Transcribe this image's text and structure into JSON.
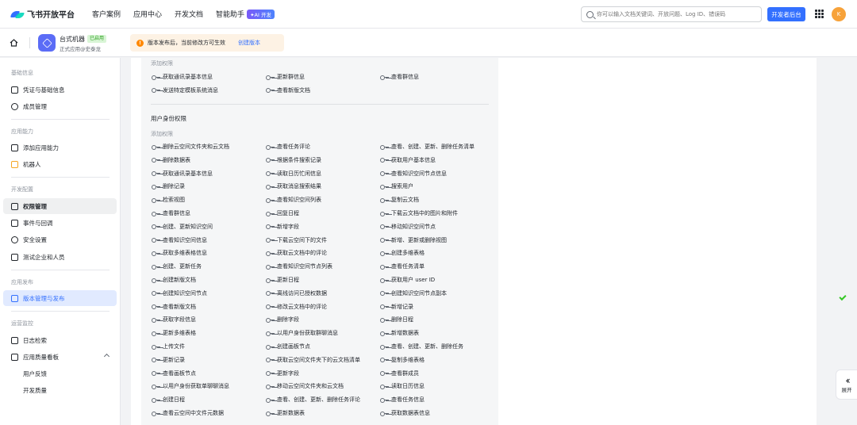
{
  "topnav": {
    "logo_text": "飞书开放平台",
    "links": [
      "客户案例",
      "应用中心",
      "开发文档"
    ],
    "ai_link": "智能助手",
    "ai_badge": "✦AI 开发",
    "search_placeholder": "你可以输入文档关键词、开放问题、Log ID、错误码",
    "dev_button": "开发者后台",
    "avatar_initial": "K"
  },
  "appbar": {
    "app_name": "台式机器",
    "app_badge": "已启用",
    "app_subtitle": "正式应用@史泰龙",
    "notice_text": "版本发布后，当前修改方可生效",
    "notice_link": "创建版本"
  },
  "sidebar": {
    "groups": [
      "基础信息",
      "应用能力",
      "开发配置",
      "应用发布",
      "运营监控"
    ],
    "items": [
      {
        "label": "凭证与基础信息"
      },
      {
        "label": "成员管理"
      },
      {
        "label": "添加应用能力"
      },
      {
        "label": "机器人"
      },
      {
        "label": "权限管理"
      },
      {
        "label": "事件与回调"
      },
      {
        "label": "安全设置"
      },
      {
        "label": "测试企业和人员"
      },
      {
        "label": "版本管理与发布"
      },
      {
        "label": "日志检索"
      },
      {
        "label": "应用质量看板"
      },
      {
        "label": "用户反馈"
      },
      {
        "label": "开发质量"
      }
    ]
  },
  "main": {
    "tenant_added_label": "添加权限",
    "tenant_permissions": [
      "获取通讯录基本信息",
      "更新群信息",
      "查看群信息",
      "发送特定模板系统消息",
      "查看新版文档"
    ],
    "user_section_title": "用户身份权限",
    "user_added_label": "添加权限",
    "user_permissions": [
      "删除云空间文件夹和云文档",
      "查看任务评论",
      "查看、创建、更新、删除任务清单",
      "删除数据表",
      "根据条件搜索记录",
      "获取用户基本信息",
      "获取通讯录基本信息",
      "读取日历忙闲信息",
      "查看知识空间节点信息",
      "删除记录",
      "获取消息搜索结果",
      "搜索用户",
      "检索视图",
      "查看知识空间列表",
      "复制云文档",
      "查看群信息",
      "回复日程",
      "下载云文档中的图片和附件",
      "创建、更新知识空间",
      "新增字段",
      "移动知识空间节点",
      "查看知识空间信息",
      "下载云空间下的文件",
      "新增、更新或删除视图",
      "获取多维表格信息",
      "获取云文档中的评论",
      "创建多维表格",
      "创建、更新任务",
      "查看知识空间节点列表",
      "查看任务清单",
      "创建新版文档",
      "更新日程",
      "获取用户 user ID",
      "创建知识空间节点",
      "离线访问已授权数据",
      "创建知识空间节点副本",
      "查看新版文档",
      "修改云文档中的评论",
      "新增记录",
      "获取字段信息",
      "删除字段",
      "删除日程",
      "更新多维表格",
      "以用户身份获取群聊消息",
      "新增数据表",
      "上传文件",
      "创建画板节点",
      "查看、创建、更新、删除任务",
      "更新记录",
      "获取云空间文件夹下的云文档清单",
      "复制多维表格",
      "查看画板节点",
      "更新字段",
      "查看群成员",
      "以用户身份获取单聊聊消息",
      "移动云空间文件夹和云文档",
      "读取日历信息",
      "创建日程",
      "查看、创建、更新、删除任务评论",
      "查看任务信息",
      "查看云空间中文件元数据",
      "更新数据表",
      "获取数据表信息"
    ]
  },
  "expand_label": "展开"
}
